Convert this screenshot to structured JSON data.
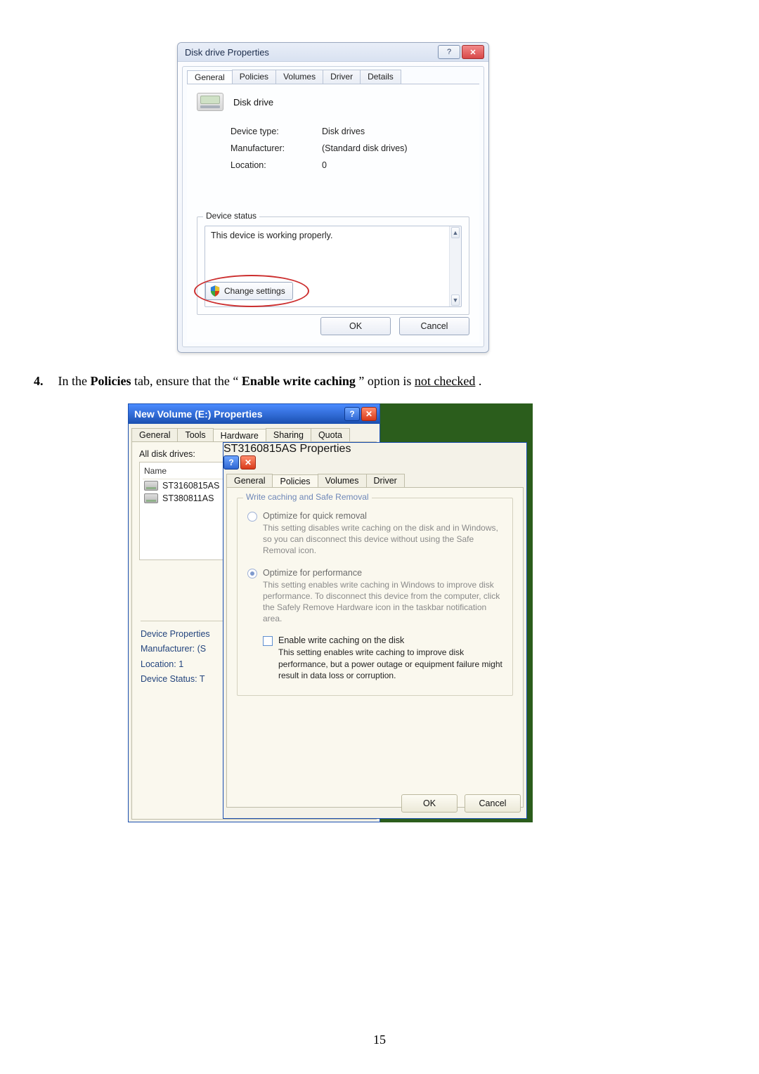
{
  "dialog1": {
    "title": "Disk drive Properties",
    "tabs": [
      "General",
      "Policies",
      "Volumes",
      "Driver",
      "Details"
    ],
    "active_tab_index": 0,
    "device_name": "Disk drive",
    "fields": {
      "device_type_label": "Device type:",
      "device_type_value": "Disk drives",
      "manufacturer_label": "Manufacturer:",
      "manufacturer_value": "(Standard disk drives)",
      "location_label": "Location:",
      "location_value": "0"
    },
    "status_group_label": "Device status",
    "status_text": "This device is working properly.",
    "change_settings_label": "Change settings",
    "buttons": {
      "ok": "OK",
      "cancel": "Cancel"
    }
  },
  "instruction": {
    "number": "4.",
    "pre": "In the ",
    "bold1": "Policies",
    "mid": " tab, ensure that the “",
    "bold2": "Enable write caching",
    "post": "” option is ",
    "underlined": "not checked",
    "end": "."
  },
  "dialog_outer": {
    "title": "New Volume (E:) Properties",
    "tabs": [
      "General",
      "Tools",
      "Hardware",
      "Sharing",
      "Quota"
    ],
    "active_tab_index": 2,
    "list_label": "All disk drives:",
    "list_header": "Name",
    "list_items": [
      "ST3160815AS",
      "ST380811AS"
    ],
    "props_header": "Device Properties",
    "props_lines": [
      "Manufacturer: (S",
      "Location: 1",
      "Device Status: T"
    ]
  },
  "dialog_inner": {
    "title": "ST3160815AS Properties",
    "tabs": [
      "General",
      "Policies",
      "Volumes",
      "Driver"
    ],
    "active_tab_index": 1,
    "group_label": "Write caching and Safe Removal",
    "option1": {
      "label": "Optimize for quick removal",
      "desc": "This setting disables write caching on the disk and in Windows, so you can disconnect this device without using the Safe Removal icon.",
      "checked": false,
      "disabled": true
    },
    "option2": {
      "label": "Optimize for performance",
      "desc": "This setting enables write caching in Windows to improve disk performance. To disconnect this device from the computer, click the Safely Remove Hardware icon in the taskbar notification area.",
      "checked": true,
      "disabled": true
    },
    "write_caching": {
      "label": "Enable write caching on the disk",
      "checked": false,
      "desc": "This setting enables write caching to improve disk performance, but a power outage or equipment failure might result in data loss or corruption."
    },
    "buttons": {
      "ok": "OK",
      "cancel": "Cancel"
    }
  },
  "page_number": "15"
}
